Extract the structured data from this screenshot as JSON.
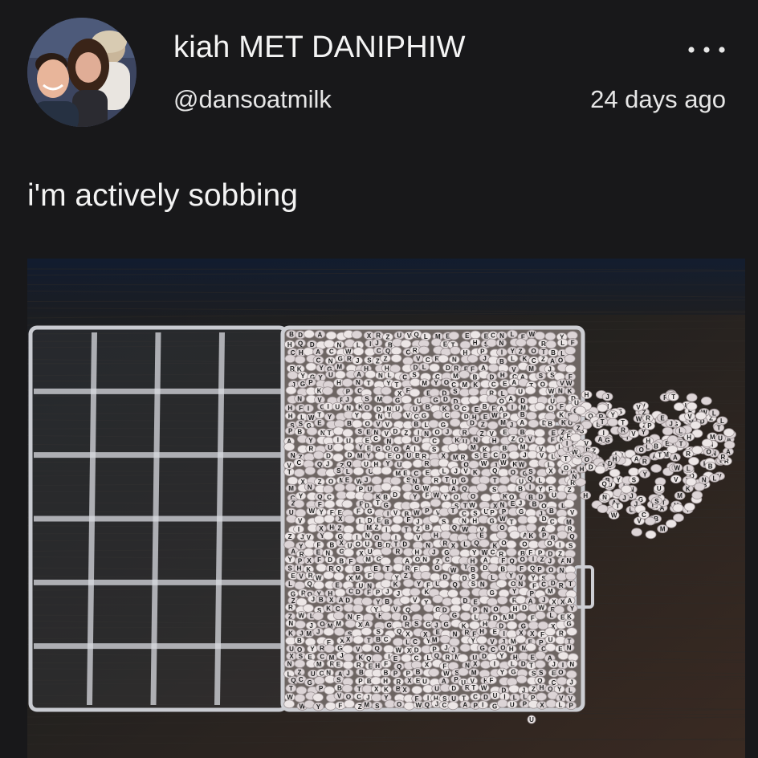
{
  "post": {
    "display_name": "kiah MET DANIPHIW",
    "handle": "@dansoatmilk",
    "timestamp": "24 days ago",
    "text": "i'm actively sobbing",
    "more_icon": "more-horizontal-icon"
  },
  "media": {
    "bead_letters": "ABCDEFGHIJKLMNOPQRSTUVWXYZ"
  }
}
